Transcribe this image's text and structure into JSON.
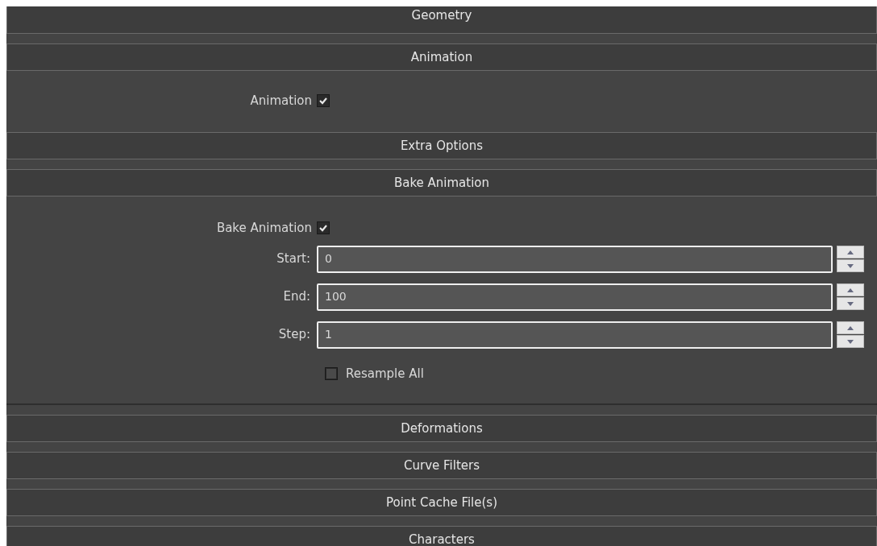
{
  "rollouts": [
    {
      "title": "Geometry"
    },
    {
      "title": "Animation",
      "controls": [
        {
          "kind": "checkbox",
          "label": "Animation",
          "checked": true
        }
      ]
    },
    {
      "title": "Extra Options"
    },
    {
      "title": "Bake Animation",
      "controls": [
        {
          "kind": "checkbox",
          "label": "Bake Animation",
          "checked": true
        },
        {
          "kind": "spinner",
          "label": "Start:",
          "value": "0"
        },
        {
          "kind": "spinner",
          "label": "End:",
          "value": "100"
        },
        {
          "kind": "spinner",
          "label": "Step:",
          "value": "1"
        },
        {
          "kind": "check-right",
          "label": "Resample All",
          "checked": false
        }
      ]
    },
    {
      "title": "Deformations"
    },
    {
      "title": "Curve Filters"
    },
    {
      "title": "Point Cache File(s)"
    },
    {
      "title": "Characters"
    }
  ]
}
